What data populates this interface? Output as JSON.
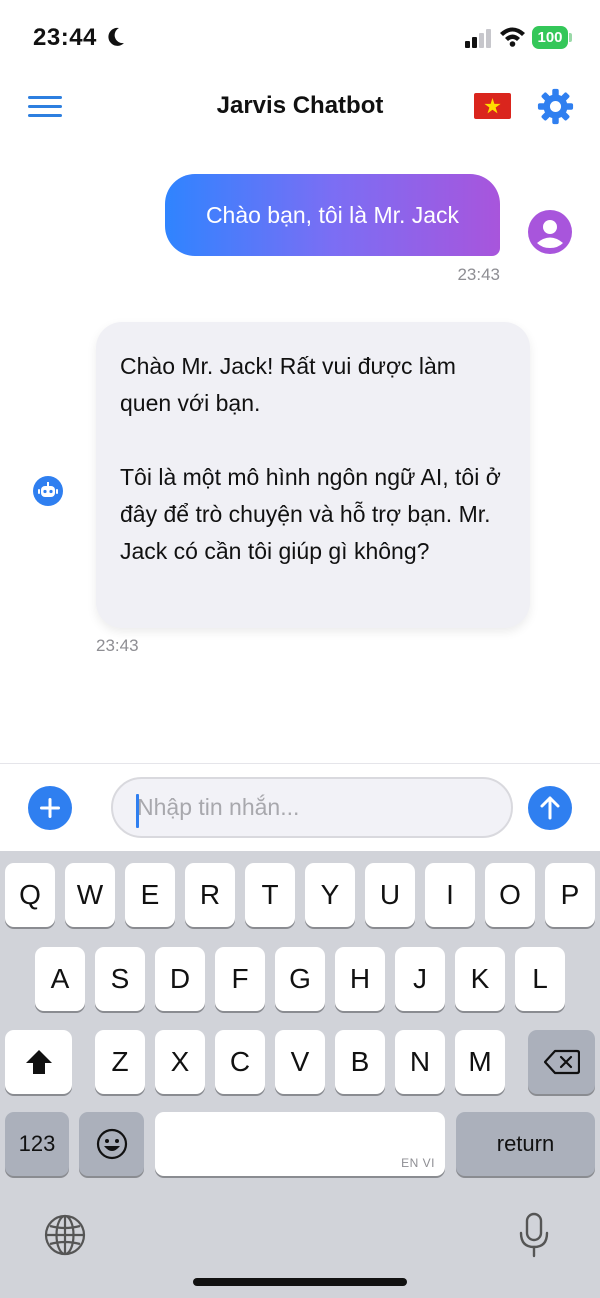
{
  "status_bar": {
    "time": "23:44",
    "battery": "100"
  },
  "header": {
    "title": "Jarvis Chatbot"
  },
  "messages": {
    "user": {
      "text": "Chào bạn, tôi là Mr. Jack",
      "time": "23:43"
    },
    "bot": {
      "text": "Chào Mr. Jack! Rất vui được làm quen với bạn.\n\nTôi là một mô hình ngôn ngữ AI, tôi ở đây để trò chuyện và hỗ trợ bạn. Mr. Jack có cần tôi giúp gì không?",
      "time": "23:43"
    }
  },
  "input": {
    "placeholder": "Nhập tin nhắn..."
  },
  "keyboard": {
    "row1": [
      "Q",
      "W",
      "E",
      "R",
      "T",
      "Y",
      "U",
      "I",
      "O",
      "P"
    ],
    "row2": [
      "A",
      "S",
      "D",
      "F",
      "G",
      "H",
      "J",
      "K",
      "L"
    ],
    "row3": [
      "Z",
      "X",
      "C",
      "V",
      "B",
      "N",
      "M"
    ],
    "numbers_label": "123",
    "return_label": "return",
    "space_hint": "EN VI"
  },
  "colors": {
    "accent": "#2f7ff0",
    "user_bubble_start": "#2f84ff",
    "user_bubble_end": "#a855dc",
    "battery": "#34c759"
  },
  "icons": [
    "menu-icon",
    "vietnam-flag-icon",
    "gear-icon",
    "user-avatar-icon",
    "bot-icon",
    "plus-icon",
    "send-icon",
    "shift-icon",
    "backspace-icon",
    "emoji-icon",
    "globe-icon",
    "microphone-icon",
    "moon-icon",
    "signal-icon",
    "wifi-icon"
  ]
}
